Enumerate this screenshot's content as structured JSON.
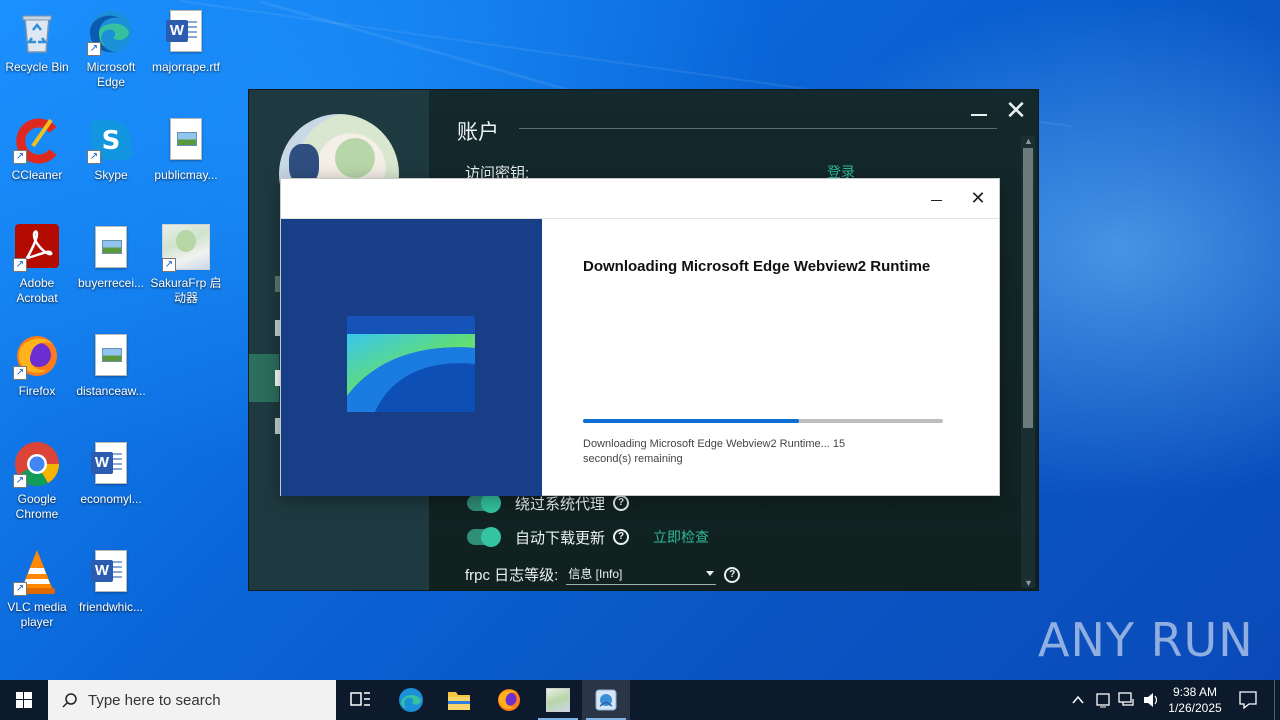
{
  "desktop": {
    "icons": [
      {
        "name": "recycle-bin",
        "label": "Recycle Bin"
      },
      {
        "name": "microsoft-edge",
        "label": "Microsoft\nEdge"
      },
      {
        "name": "majorrape-rtf",
        "label": "majorrape.rtf"
      },
      {
        "name": "ccleaner",
        "label": "CCleaner"
      },
      {
        "name": "skype",
        "label": "Skype"
      },
      {
        "name": "publicmay",
        "label": "publicmay..."
      },
      {
        "name": "adobe-acrobat",
        "label": "Adobe\nAcrobat"
      },
      {
        "name": "buyerrecei",
        "label": "buyerrecei..."
      },
      {
        "name": "sakurafrp",
        "label": "SakuraFrp 启\n动器"
      },
      {
        "name": "firefox",
        "label": "Firefox"
      },
      {
        "name": "distanceaw",
        "label": "distanceaw..."
      },
      {
        "name": "google-chrome",
        "label": "Google\nChrome"
      },
      {
        "name": "economyl",
        "label": "economyl..."
      },
      {
        "name": "vlc",
        "label": "VLC media\nplayer"
      },
      {
        "name": "friendwhic",
        "label": "friendwhic..."
      }
    ]
  },
  "app": {
    "section_title": "账户",
    "access_key_label": "访问密钥:",
    "login_link": "登录",
    "bypass_proxy_label": "绕过系统代理",
    "auto_update_label": "自动下载更新",
    "check_now_link": "立即检查",
    "log_level_label": "frpc 日志等级:",
    "log_level_value": "信息 [Info]",
    "help_glyph": "?"
  },
  "dialog": {
    "heading": "Downloading Microsoft Edge Webview2 Runtime",
    "status": "Downloading Microsoft Edge Webview2 Runtime... 15 second(s) remaining",
    "progress": 0.6,
    "close_glyph": "✕"
  },
  "watermark": "ANY RUN",
  "taskbar": {
    "search_placeholder": "Type here to search",
    "time": "9:38 AM",
    "date": "1/26/2025"
  },
  "colors": {
    "accent_green": "#2fb89a",
    "progress_blue": "#0c6fd1",
    "installer_panel": "#173e86"
  }
}
